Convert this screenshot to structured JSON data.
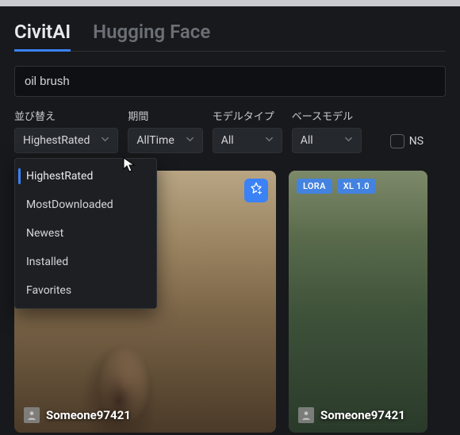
{
  "tabs": [
    {
      "label": "CivitAI",
      "active": true
    },
    {
      "label": "Hugging Face",
      "active": false
    }
  ],
  "search": {
    "value": "oil brush"
  },
  "filters": {
    "sort": {
      "label": "並び替え",
      "value": "HighestRated"
    },
    "period": {
      "label": "期間",
      "value": "AllTime"
    },
    "modelType": {
      "label": "モデルタイプ",
      "value": "All"
    },
    "baseModel": {
      "label": "ベースモデル",
      "value": "All"
    }
  },
  "sort_options": [
    {
      "label": "HighestRated",
      "active": true
    },
    {
      "label": "MostDownloaded",
      "active": false
    },
    {
      "label": "Newest",
      "active": false
    },
    {
      "label": "Installed",
      "active": false
    },
    {
      "label": "Favorites",
      "active": false
    }
  ],
  "nsfw": {
    "label": "NS",
    "checked": false
  },
  "cards": [
    {
      "author": "Someone97421",
      "badges": [],
      "has_star": true
    },
    {
      "author": "Someone97421",
      "badges": [
        "LORA",
        "XL 1.0"
      ],
      "has_star": false
    }
  ]
}
